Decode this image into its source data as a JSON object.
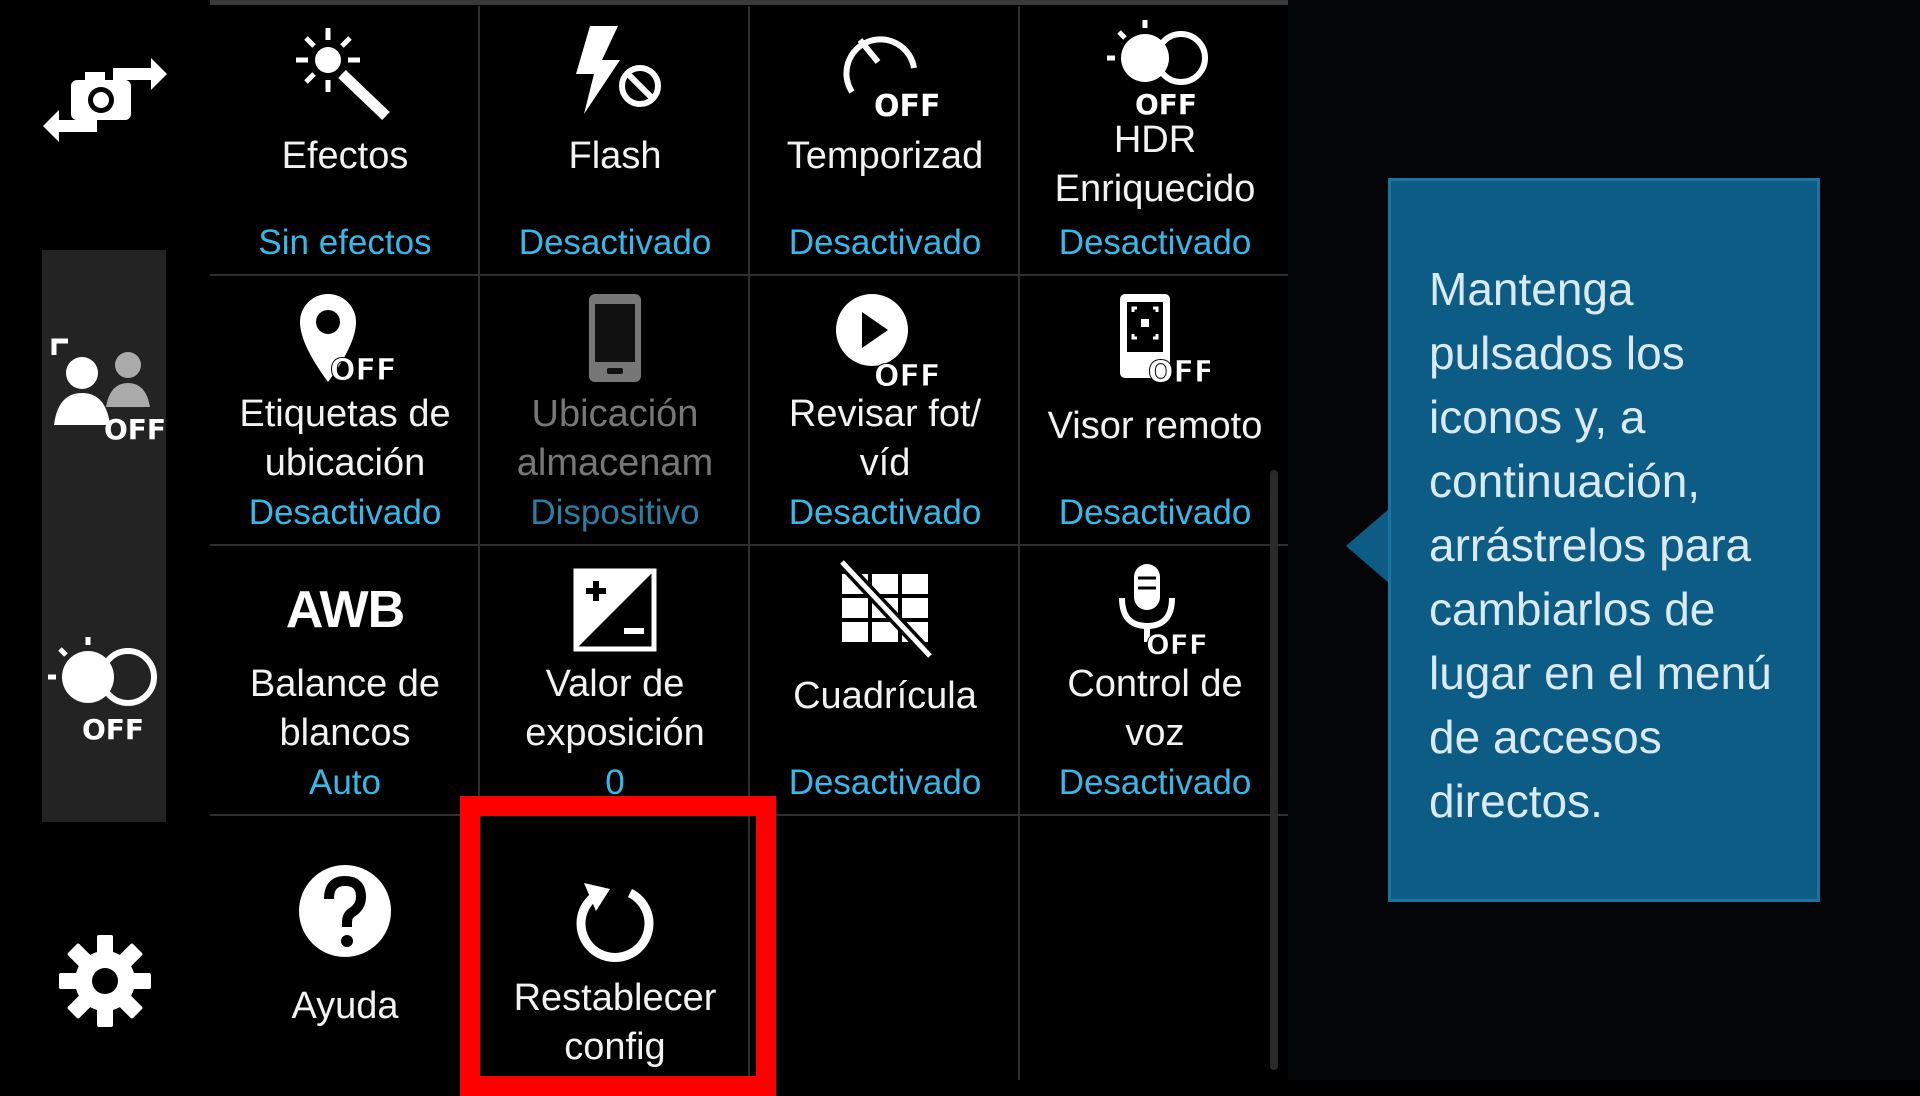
{
  "sidebar": {
    "switch_camera": {
      "icon": "switch-camera-icon"
    },
    "face_detection": {
      "icon": "face-detection-icon",
      "badge": "OFF"
    },
    "hdr": {
      "icon": "hdr-icon",
      "badge": "OFF"
    },
    "settings": {
      "icon": "gear-icon"
    }
  },
  "grid": {
    "cells": [
      {
        "label": "Efectos",
        "value": "Sin efectos",
        "icon": "effects-wand-icon"
      },
      {
        "label": "Flash",
        "value": "Desactivado",
        "icon": "flash-off-icon"
      },
      {
        "label": "Temporizad",
        "value": "Desactivado",
        "icon": "timer-off-icon",
        "badge": "OFF"
      },
      {
        "label": "HDR\nEnriquecido",
        "value": "Desactivado",
        "icon": "hdr-icon",
        "badge": "OFF"
      },
      {
        "label": "Etiquetas de\nubicación",
        "value": "Desactivado",
        "icon": "location-tag-icon",
        "badge": "OFF"
      },
      {
        "label": "Ubicación\nalmacenam",
        "value": "Dispositivo",
        "icon": "phone-storage-icon"
      },
      {
        "label": "Revisar fot/\nvíd",
        "value": "Desactivado",
        "icon": "review-play-icon",
        "badge": "OFF"
      },
      {
        "label": "Visor remoto",
        "value": "Desactivado",
        "icon": "remote-viewfinder-icon",
        "badge": "OFF"
      },
      {
        "label": "Balance de\nblancos",
        "value": "Auto",
        "icon": "awb-icon",
        "icon_text": "AWB"
      },
      {
        "label": "Valor de\nexposición",
        "value": "0",
        "icon": "exposure-icon"
      },
      {
        "label": "Cuadrícula",
        "value": "Desactivado",
        "icon": "grid-off-icon"
      },
      {
        "label": "Control de\nvoz",
        "value": "Desactivado",
        "icon": "voice-control-icon",
        "badge": "OFF"
      },
      {
        "label": "Ayuda",
        "value": "",
        "icon": "help-icon"
      },
      {
        "label": "Restablecer\nconfig",
        "value": "",
        "icon": "reset-icon"
      }
    ]
  },
  "tooltip": {
    "text": "Mantenga pulsados los iconos y, a continuación, arrástrelos para cambiarlos de lugar en el menú de accesos directos."
  },
  "colors": {
    "background": "#000000",
    "value_text": "#35b9e8",
    "tooltip_bg": "#0d5c86",
    "highlight": "#ff0000"
  }
}
